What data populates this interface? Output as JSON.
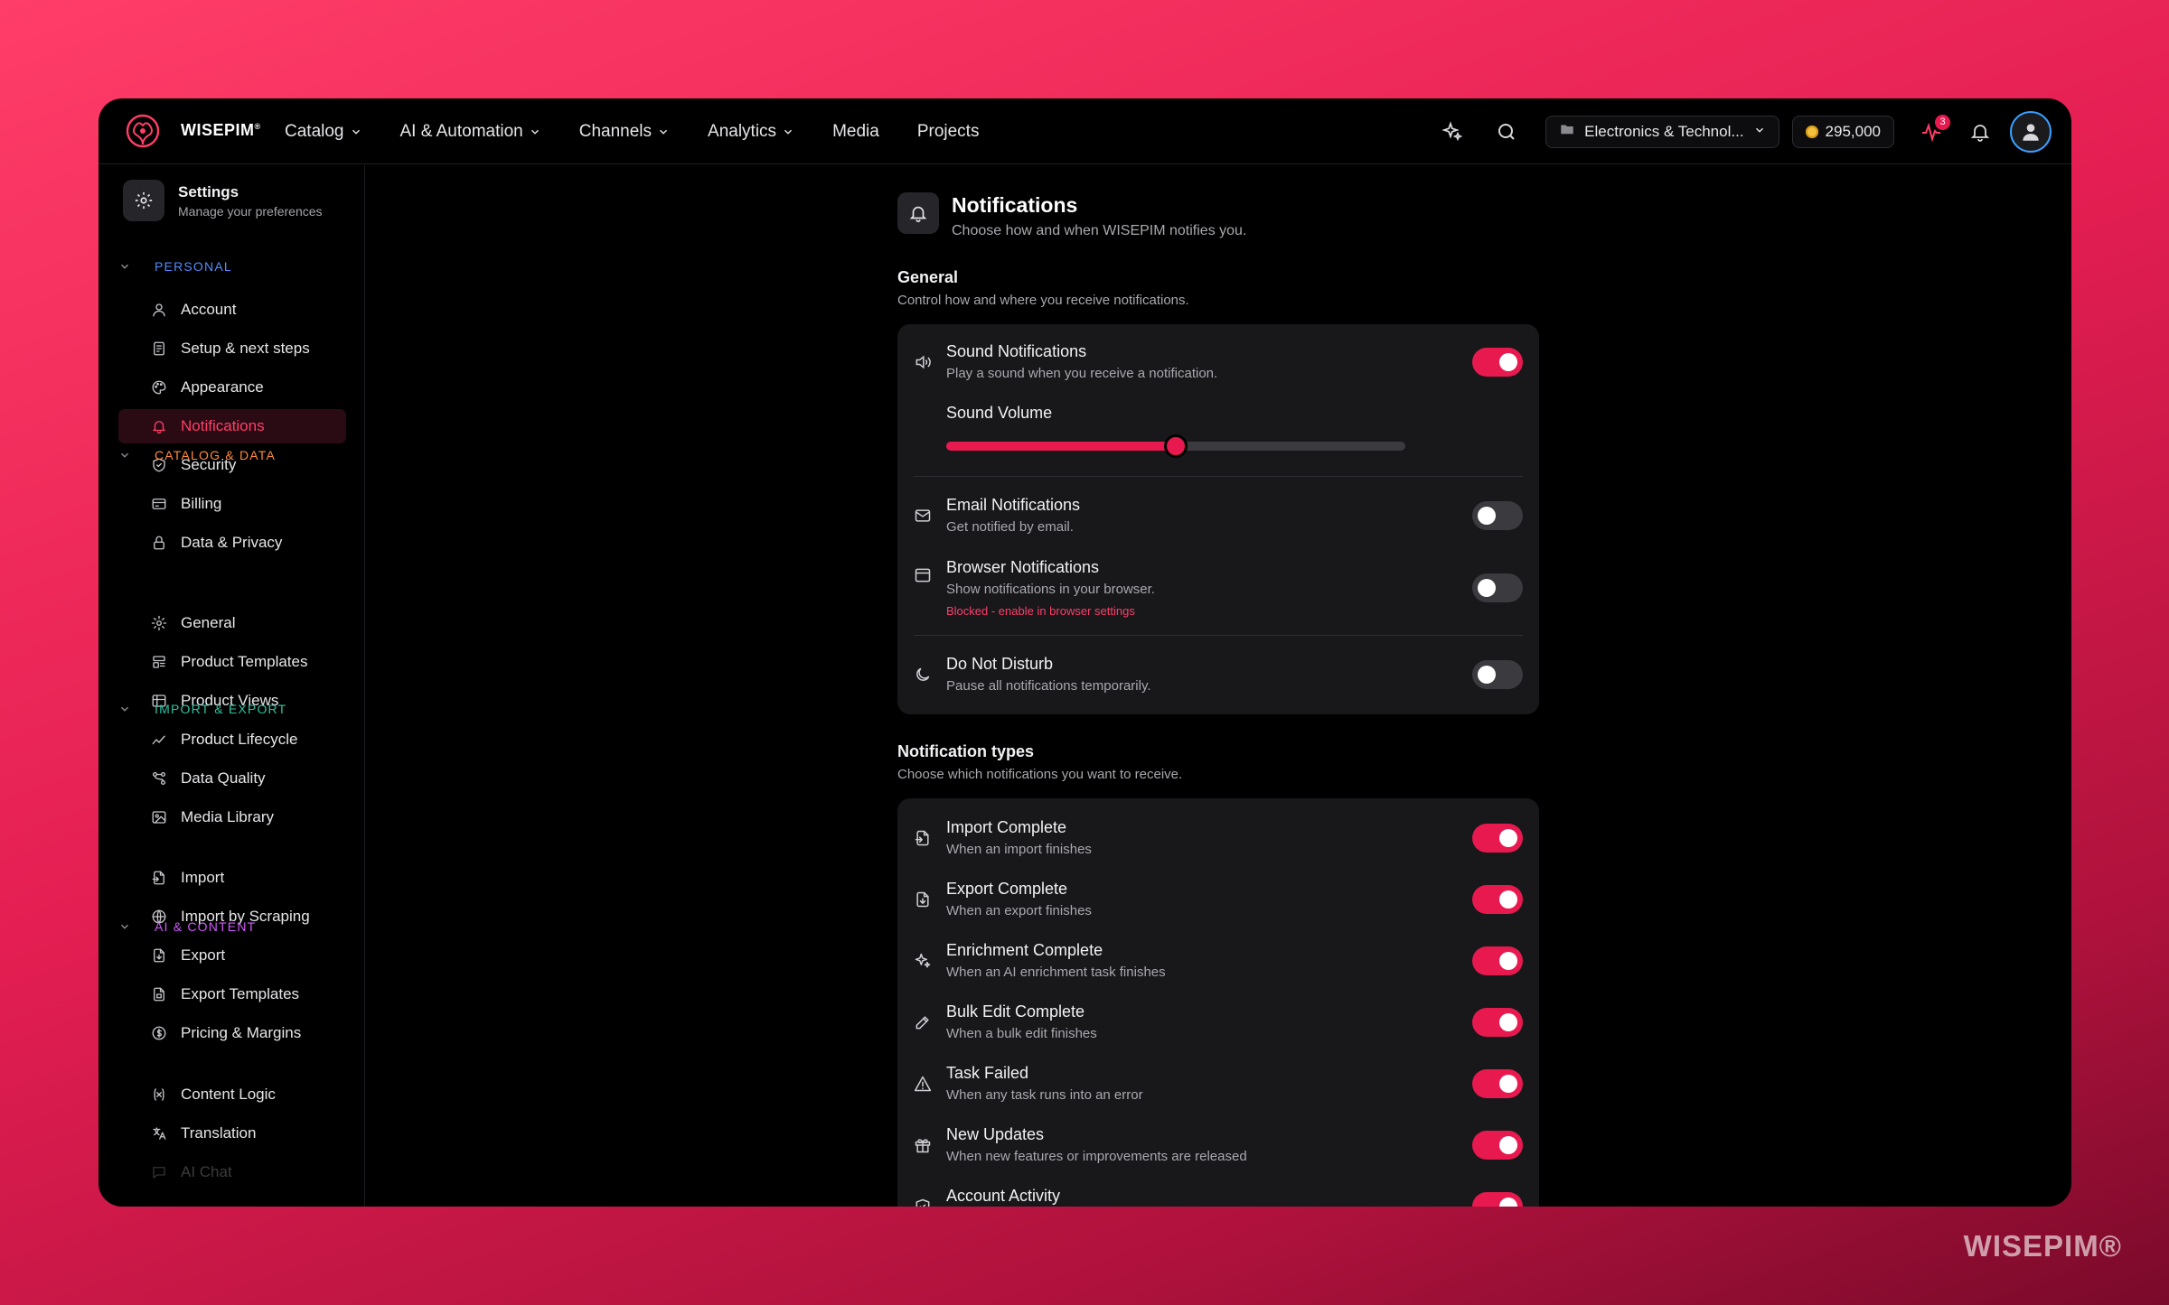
{
  "brand": {
    "logo_text": "WISEPIM",
    "logo_mark": "®",
    "watermark": "WISEPIM®"
  },
  "nav": [
    {
      "label": "Catalog",
      "dropdown": true
    },
    {
      "label": "AI & Automation",
      "dropdown": true
    },
    {
      "label": "Channels",
      "dropdown": true
    },
    {
      "label": "Analytics",
      "dropdown": true
    },
    {
      "label": "Media",
      "dropdown": false
    },
    {
      "label": "Projects",
      "dropdown": false
    }
  ],
  "topbar": {
    "workspace": "Electronics & Technol...",
    "credits": "295,000",
    "activity_badge": "3"
  },
  "sidebar": {
    "title": "Settings",
    "subtitle": "Manage your preferences",
    "sections": [
      {
        "label": "PERSONAL",
        "color": "#4f8cff"
      },
      {
        "label": "CATALOG & DATA",
        "color": "#ff8a3d"
      },
      {
        "label": "IMPORT & EXPORT",
        "color": "#2ec4a0"
      },
      {
        "label": "AI & CONTENT",
        "color": "#d35aff"
      }
    ],
    "items": [
      {
        "label": "Account",
        "icon": "user-icon"
      },
      {
        "label": "Setup & next steps",
        "icon": "checklist-icon"
      },
      {
        "label": "Appearance",
        "icon": "palette-icon"
      },
      {
        "label": "Notifications",
        "icon": "bell-icon",
        "active": true
      },
      {
        "label": "Security",
        "icon": "shield-icon"
      },
      {
        "label": "Billing",
        "icon": "credit-card-icon"
      },
      {
        "label": "Data & Privacy",
        "icon": "lock-icon"
      },
      {
        "label": "General",
        "icon": "gear-icon"
      },
      {
        "label": "Product Templates",
        "icon": "template-icon"
      },
      {
        "label": "Product Views",
        "icon": "table-icon"
      },
      {
        "label": "Product Lifecycle",
        "icon": "chart-line-icon"
      },
      {
        "label": "Data Quality",
        "icon": "flow-icon"
      },
      {
        "label": "Media Library",
        "icon": "image-icon"
      },
      {
        "label": "Import",
        "icon": "file-import-icon"
      },
      {
        "label": "Import by Scraping",
        "icon": "globe-icon"
      },
      {
        "label": "Export",
        "icon": "file-export-icon"
      },
      {
        "label": "Export Templates",
        "icon": "file-template-icon"
      },
      {
        "label": "Pricing & Margins",
        "icon": "dollar-circle-icon"
      },
      {
        "label": "Content Logic",
        "icon": "variable-icon"
      },
      {
        "label": "Translation",
        "icon": "translate-icon"
      },
      {
        "label": "AI Chat",
        "icon": "chat-icon"
      }
    ]
  },
  "page": {
    "title": "Notifications",
    "subtitle": "Choose how and when WISEPIM notifies you."
  },
  "general": {
    "title": "General",
    "subtitle": "Control how and where you receive notifications.",
    "sound": {
      "title": "Sound Notifications",
      "sub": "Play a sound when you receive a notification.",
      "on": true
    },
    "volume_label": "Sound Volume",
    "volume_fraction": 0.5,
    "email": {
      "title": "Email Notifications",
      "sub": "Get notified by email.",
      "on": false
    },
    "browser": {
      "title": "Browser Notifications",
      "sub": "Show notifications in your browser.",
      "warning": "Blocked - enable in browser settings",
      "on": false
    },
    "dnd": {
      "title": "Do Not Disturb",
      "sub": "Pause all notifications temporarily.",
      "on": false
    }
  },
  "types": {
    "title": "Notification types",
    "subtitle": "Choose which notifications you want to receive.",
    "items": [
      {
        "title": "Import Complete",
        "sub": "When an import finishes",
        "icon": "file-import-icon",
        "on": true
      },
      {
        "title": "Export Complete",
        "sub": "When an export finishes",
        "icon": "file-export-icon",
        "on": true
      },
      {
        "title": "Enrichment Complete",
        "sub": "When an AI enrichment task finishes",
        "icon": "sparkles-icon",
        "on": true
      },
      {
        "title": "Bulk Edit Complete",
        "sub": "When a bulk edit finishes",
        "icon": "edit-icon",
        "on": true
      },
      {
        "title": "Task Failed",
        "sub": "When any task runs into an error",
        "icon": "warning-icon",
        "on": true
      },
      {
        "title": "New Updates",
        "sub": "When new features or improvements are released",
        "icon": "gift-icon",
        "on": true
      },
      {
        "title": "Account Activity",
        "sub": "",
        "icon": "shield-icon",
        "on": true
      }
    ]
  }
}
